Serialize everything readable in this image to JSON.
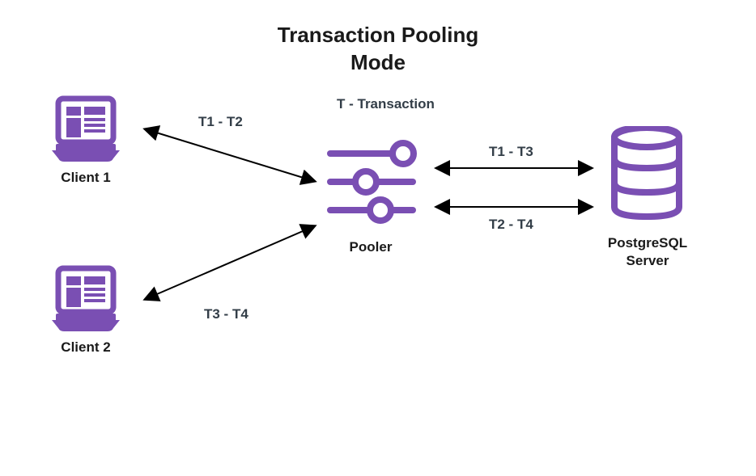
{
  "title_line1": "Transaction Pooling",
  "title_line2": "Mode",
  "legend": "T - Transaction",
  "client1": {
    "label": "Client 1"
  },
  "client2": {
    "label": "Client 2"
  },
  "pooler": {
    "label": "Pooler"
  },
  "server": {
    "label_line1": "PostgreSQL",
    "label_line2": "Server"
  },
  "edges": {
    "c1_pooler": "T1 - T2",
    "c2_pooler": "T3 - T4",
    "pooler_server_top": "T1 - T3",
    "pooler_server_bottom": "T2 - T4"
  },
  "colors": {
    "purple": "#7a4fb3",
    "text": "#333e48"
  }
}
